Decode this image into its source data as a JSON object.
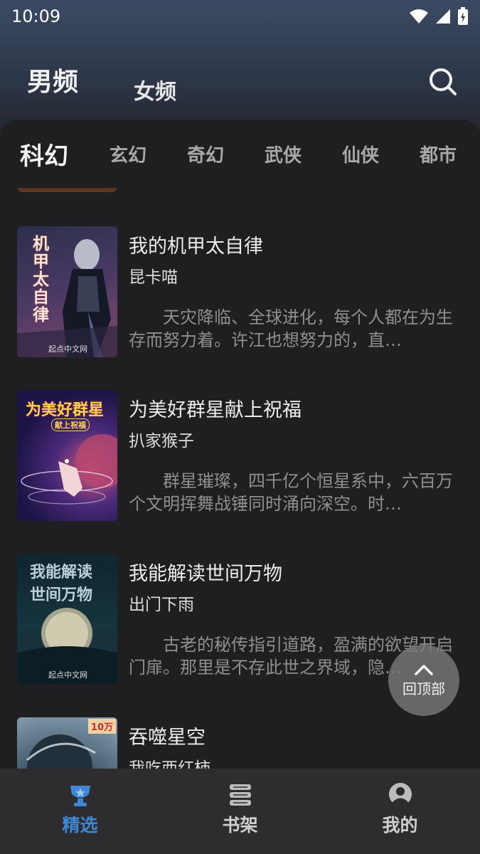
{
  "status_bar": {
    "time": "10:09"
  },
  "header": {
    "tabs": [
      {
        "label": "男频",
        "active": true
      },
      {
        "label": "女频",
        "active": false
      }
    ]
  },
  "categories": [
    "科幻",
    "玄幻",
    "奇幻",
    "武侠",
    "仙侠",
    "都市"
  ],
  "books": [
    {
      "title": "我的机甲太自律",
      "author": "昆卡喵",
      "description": "天灾降临、全球进化，每个人都在为生存而努力着。许江也想努力的，直…",
      "cover": {
        "title_lines": [
          "机",
          "甲",
          "太",
          "自",
          "律"
        ],
        "publisher": "起点中文网",
        "colors": [
          "#2b2f4a",
          "#5a3d64",
          "#b05a6e"
        ]
      }
    },
    {
      "title": "为美好群星献上祝福",
      "author": "扒家猴子",
      "description": "群星璀璨，四千亿个恒星系中，六百万个文明挥舞战锤同时涌向深空。时…",
      "cover": {
        "title_line": "为美好群星",
        "subtitle": "献上祝福",
        "colors": [
          "#1d1446",
          "#4a2a7a",
          "#d8567a"
        ]
      }
    },
    {
      "title": "我能解读世间万物",
      "author": "出门下雨",
      "description": "古老的秘传指引道路，盈满的欲望开启门扉。那里是不存此世之界域，隐…",
      "cover": {
        "title_lines": [
          "我能解读",
          "世间万物"
        ],
        "publisher": "起点中文网",
        "colors": [
          "#0f2530",
          "#16343e",
          "#2c4a4c"
        ]
      }
    },
    {
      "title": "吞噬星空",
      "author": "我吃西红柿",
      "description": "",
      "cover": {
        "badge": "10万",
        "colors": [
          "#5d7c92",
          "#33475a",
          "#14202b"
        ]
      }
    }
  ],
  "back_to_top": {
    "label": "回顶部"
  },
  "bottom_nav": [
    {
      "label": "精选",
      "icon": "trophy-icon",
      "active": true
    },
    {
      "label": "书架",
      "icon": "bookshelf-icon",
      "active": false
    },
    {
      "label": "我的",
      "icon": "profile-icon",
      "active": false
    }
  ],
  "accent_color": "#3f86d6"
}
